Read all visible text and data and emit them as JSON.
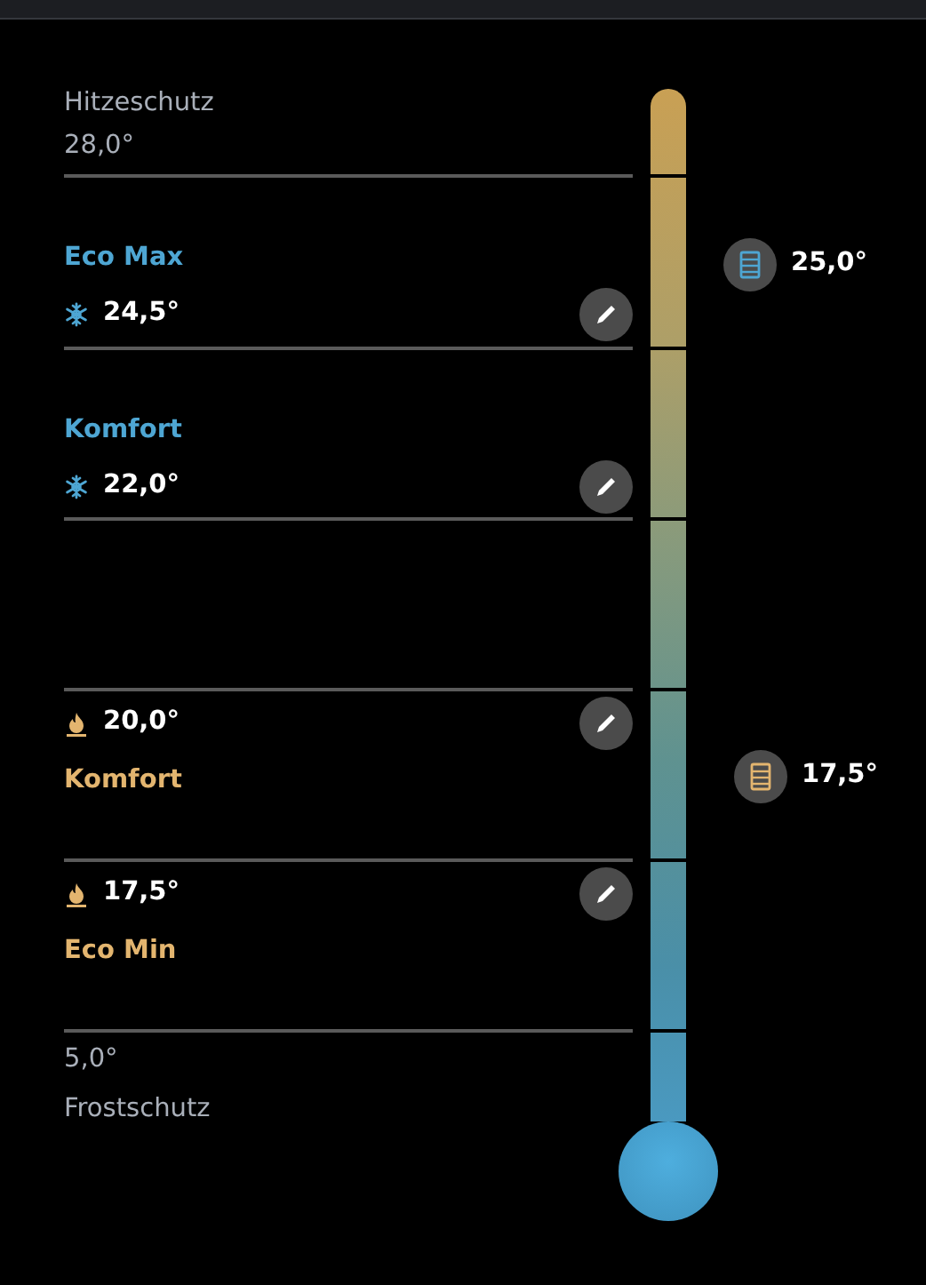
{
  "zones": [
    {
      "kind": "upper_limit",
      "name": "Hitzeschutz",
      "value": "28,0°"
    },
    {
      "kind": "cooling",
      "name": "Eco Max",
      "value": "24,5°",
      "marker": {
        "kind": "cooling",
        "value": "25,0°"
      }
    },
    {
      "kind": "cooling",
      "name": "Komfort",
      "value": "22,0°"
    },
    {
      "kind": "gap"
    },
    {
      "kind": "heating",
      "name": "Komfort",
      "value": "20,0°",
      "marker": {
        "kind": "heating",
        "value": "17,5°"
      }
    },
    {
      "kind": "heating",
      "name": "Eco Min",
      "value": "17,5°"
    },
    {
      "kind": "lower_limit",
      "value": "5,0°",
      "name": "Frostschutz"
    }
  ]
}
